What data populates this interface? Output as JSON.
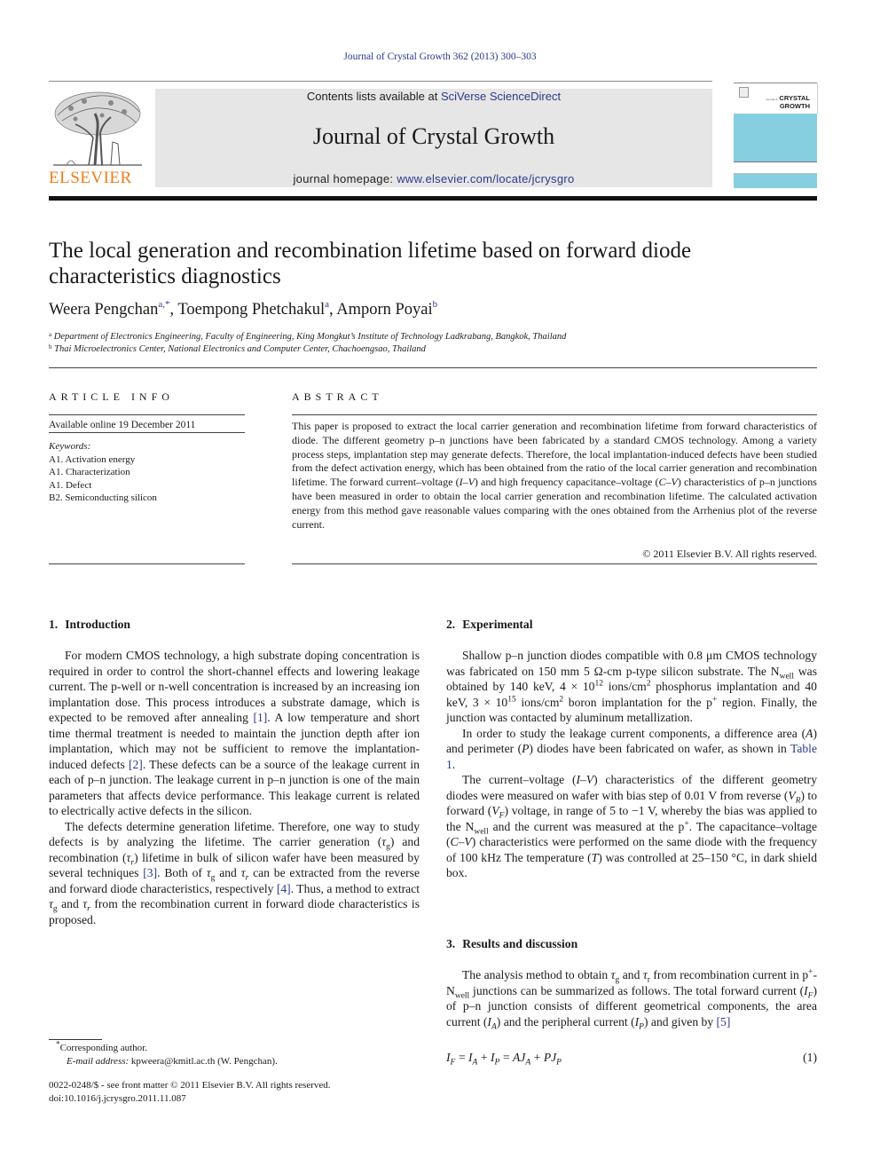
{
  "citation": "Journal of Crystal Growth 362 (2013) 300–303",
  "masthead": {
    "publisher_logo_text": "ELSEVIER",
    "contents_prefix": "Contents lists available at ",
    "contents_link": "SciVerse ScienceDirect",
    "journal_title": "Journal of Crystal Growth",
    "homepage_prefix": "journal homepage: ",
    "homepage_link": "www.elsevier.com/locate/jcrysgro",
    "cover_title_line1": "CRYSTAL",
    "cover_title_line2": "GROWTH",
    "cover_small": "journal of"
  },
  "article": {
    "title": "The local generation and recombination lifetime based on forward diode characteristics diagnostics",
    "authors": [
      {
        "name": "Weera Pengchan",
        "sup": "a,*"
      },
      {
        "name": "Toempong Phetchakul",
        "sup": "a"
      },
      {
        "name": "Amporn Poyai",
        "sup": "b"
      }
    ],
    "affiliations": [
      {
        "sup": "a",
        "text": "Department of Electronics Engineering, Faculty of Engineering, King Mongkut’s Institute of Technology Ladkrabang, Bangkok, Thailand"
      },
      {
        "sup": "b",
        "text": "Thai Microelectronics Center, National Electronics and Computer Center, Chachoengsao, Thailand"
      }
    ]
  },
  "article_info": {
    "heading": "ARTICLE INFO",
    "available": "Available online 19 December 2011",
    "keywords_label": "Keywords:",
    "keywords": [
      "A1. Activation energy",
      "A1. Characterization",
      "A1. Defect",
      "B2. Semiconducting silicon"
    ]
  },
  "abstract": {
    "heading": "ABSTRACT",
    "p1": "This paper is proposed to extract the local carrier generation and recombination lifetime from forward characteristics of diode. The different geometry p–n junctions have been fabricated by a standard CMOS technology. Among a variety process steps, implantation step may generate defects. Therefore, the local implantation-induced defects have been studied from the defect activation energy, which has been obtained from the ratio of the local carrier generation and recombination lifetime. The forward current–voltage (",
    "iv": "I–V",
    "p2": ") and high frequency capacitance–voltage (",
    "cv": "C–V",
    "p3": ") characteristics of p–n junctions have been measured in order to obtain the local carrier generation and recombination lifetime. The calculated activation energy from this method gave reasonable values comparing with the ones obtained from the Arrhenius plot of the reverse current.",
    "copyright": "© 2011 Elsevier B.V. All rights reserved."
  },
  "sections": {
    "intro": {
      "number": "1.",
      "title": "Introduction",
      "p1a": "For modern CMOS technology, a high substrate doping concentration is required in order to control the short-channel effects and lowering leakage current. The p-well or n-well concentration is increased by an increasing ion implantation dose. This process introduces a substrate damage, which is expected to be removed after annealing ",
      "ref1": "[1]",
      "p1b": ". A low temperature and short time thermal treatment is needed to maintain the junction depth after ion implantation, which may not be sufficient to remove the implantation-induced defects ",
      "ref2": "[2]",
      "p1c": ". These defects can be a source of the leakage current in each of p–n junction. The leakage current in p–n junction is one of the main parameters that affects device performance. This leakage current is related to electrically active defects in the silicon.",
      "p2a": "The defects determine generation lifetime. Therefore, one way to study defects is by analyzing the lifetime. The carrier generation (",
      "tau": "τ",
      "g": "g",
      "r": "r",
      "p2b": ") and recombination (",
      "p2c": ") lifetime in bulk of silicon wafer have been measured by several techniques ",
      "ref3": "[3]",
      "p2d": ". Both of ",
      "and": " and ",
      "p2e": " can be extracted from the reverse and forward diode characteristics, respectively ",
      "ref4": "[4]",
      "p2f": ". Thus, a method to extract ",
      "p2g": " from the recombination current in forward diode characteristics is proposed."
    },
    "experimental": {
      "number": "2.",
      "title": "Experimental",
      "p1a": "Shallow p–n junction diodes compatible with 0.8 μm CMOS technology was fabricated on 150 mm 5 Ω-cm p-type silicon substrate. The N",
      "well": "well",
      "p1b": " was obtained by 140 keV, 4 × 10",
      "exp12": "12",
      "p1c": " ions/cm",
      "sq": "2",
      "p1d": " phosphorus implantation and 40 keV, 3 × 10",
      "exp15": "15",
      "p1e": " boron implantation for the p",
      "plus": "+",
      "p1f": " region. Finally, the junction was contacted by aluminum metallization.",
      "p2a": "In order to study the leakage current components, a difference area (",
      "A": "A",
      "p2b": ") and perimeter (",
      "P": "P",
      "p2c": ") diodes have been fabricated on wafer, as shown in ",
      "table_ref": "Table 1",
      "p2d": ".",
      "p3a": "The current–voltage (",
      "iv": "I–V",
      "p3b": ") characteristics of the different geometry diodes were measured on wafer with bias step of 0.01 V from reverse (",
      "V": "V",
      "R": "R",
      "F": "F",
      "p3c": ") to forward (",
      "p3d": ") voltage, in range of 5 to −1 V, whereby the bias was applied to the N",
      "p3e": " and the current was measured at the p",
      "p3f": ". The capacitance–voltage (",
      "cv": "C–V",
      "p3g": ") characteristics were performed on the same diode with the frequency of 100 kHz The temperature (",
      "T": "T",
      "p3h": ") was controlled at 25–150 °C, in dark shield box."
    },
    "results": {
      "number": "3.",
      "title": "Results and discussion",
      "p1a": "The analysis method to obtain ",
      "p1b": " from recombination current in p",
      "p1c": "-N",
      "p1d": " junctions can be summarized as follows. The total forward current (",
      "I": "I",
      "F": "F",
      "Asub": "A",
      "Psub": "P",
      "p1e": ") of p–n junction consists of different geometrical components, the area current (",
      "p1f": ") and the peripheral current (",
      "p1g": ") and given by ",
      "ref5": "[5]",
      "equation": "I_F = I_A + I_P = AJ_A + PJ_P",
      "equation_number": "(1)"
    }
  },
  "footnotes": {
    "corresponding": "Corresponding author.",
    "star": "*",
    "email_label": "E-mail address:",
    "email": "kpweera@kmitl.ac.th",
    "email_suffix": " (W. Pengchan).",
    "front_matter": "0022-0248/$ - see front matter © 2011 Elsevier B.V. All rights reserved.",
    "doi": "doi:10.1016/j.jcrysgro.2011.11.087"
  },
  "colors": {
    "link": "#2a3a8c",
    "elsevier_orange": "#f07d1a",
    "masthead_gray": "#e6e6e6",
    "cover_blue": "#86cfe0"
  }
}
